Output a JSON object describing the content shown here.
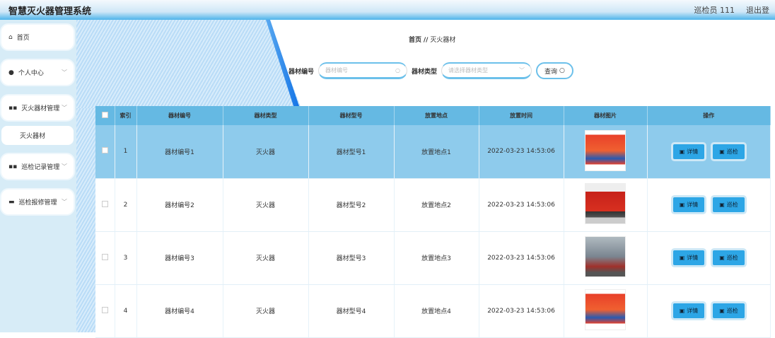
{
  "header": {
    "title": "智慧灭火器管理系统",
    "user": "巡检员 111",
    "logout": "退出登"
  },
  "sidebar": {
    "items": [
      {
        "label": "首页",
        "icon": "home-icon"
      },
      {
        "label": "个人中心",
        "icon": "user-icon"
      },
      {
        "label": "灭火器材管理",
        "icon": "grid-icon"
      },
      {
        "label": "巡检记录管理",
        "icon": "grid-icon"
      },
      {
        "label": "巡检报修管理",
        "icon": "briefcase-icon"
      }
    ],
    "sub": "灭火器材"
  },
  "breadcrumb": {
    "home": "首页",
    "sep": "//",
    "current": "灭火器材"
  },
  "search": {
    "code_label": "器材编号",
    "code_placeholder": "器材编号",
    "type_label": "器材类型",
    "type_placeholder": "请选择器材类型",
    "query": "查询"
  },
  "table": {
    "headers": [
      "索引",
      "器材编号",
      "器材类型",
      "器材型号",
      "放置地点",
      "放置时间",
      "器材图片",
      "操作"
    ],
    "rows": [
      {
        "idx": "1",
        "code": "器材编号1",
        "type": "灭火器",
        "model": "器材型号1",
        "place": "放置地点1",
        "time": "2022-03-23 14:53:06",
        "img": "box"
      },
      {
        "idx": "2",
        "code": "器材编号2",
        "type": "灭火器",
        "model": "器材型号2",
        "place": "放置地点2",
        "time": "2022-03-23 14:53:06",
        "img": "truck"
      },
      {
        "idx": "3",
        "code": "器材编号3",
        "type": "灭火器",
        "model": "器材型号3",
        "place": "放置地点3",
        "time": "2022-03-23 14:53:06",
        "img": "smoke"
      },
      {
        "idx": "4",
        "code": "器材编号4",
        "type": "灭火器",
        "model": "器材型号4",
        "place": "放置地点4",
        "time": "2022-03-23 14:53:06",
        "img": "box"
      }
    ],
    "detail": "详情",
    "inspect": "巡检"
  }
}
